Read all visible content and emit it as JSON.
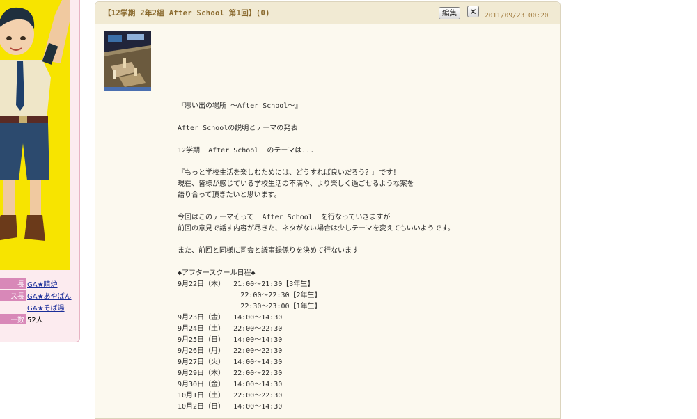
{
  "sidebar": {
    "rows": [
      {
        "label": "長",
        "value": "GA★睛炉",
        "link": true
      },
      {
        "label": "ス長",
        "value": "GA★あやぱん",
        "link": true
      },
      {
        "label": "",
        "value": "GA★そば湯",
        "link": true
      },
      {
        "label": "ー数",
        "value": "52人",
        "link": false
      }
    ]
  },
  "article": {
    "title": "【12学期 2年2組 After School 第1回】(0)",
    "edit_label": "編集",
    "close_label": "✕",
    "date": "2011/09/23 00:20",
    "body_lines": [
      "『思い出の場所 ～After School～』",
      "",
      "After Schoolの説明とテーマの発表",
      "",
      "12学期  After School  のテーマは...",
      "",
      "『もっと学校生活を楽しむためには、どうすれば良いだろう？』です！",
      "現在、皆様が感じている学校生活の不満や、より楽しく過ごせるような案を",
      "語り合って頂きたいと思います。",
      "",
      "今回はこのテーマそって  After School  を行なっていきますが",
      "前回の意見で話す内容が尽きた、ネタがない場合は少しテーマを変えてもいいようです。",
      "",
      "また、前回と同様に司会と議事録係りを決めて行ないます",
      "",
      "◆アフタースクール日程◆",
      "9月22日（木）  21:00～21:30【3年生】",
      "               22:00～22:30【2年生】",
      "               22:30～23:00【1年生】",
      "9月23日（金）  14:00～14:30",
      "9月24日（土）  22:00～22:30",
      "9月25日（日）  14:00～14:30",
      "9月26日（月）  22:00～22:30",
      "9月27日（火）  14:00～14:30",
      "9月29日（木）  22:00～22:30",
      "9月30日（金）  14:00～14:30",
      "10月1日（土）  22:00～22:30",
      "10月2日（日）  14:00～14:30"
    ]
  },
  "colors": {
    "header_bg": "#f1ead3",
    "panel_bg": "#fcf9ef",
    "title": "#8a6a2e",
    "label_pink": "#d888b8",
    "avatar_bg": "#f7e400"
  }
}
